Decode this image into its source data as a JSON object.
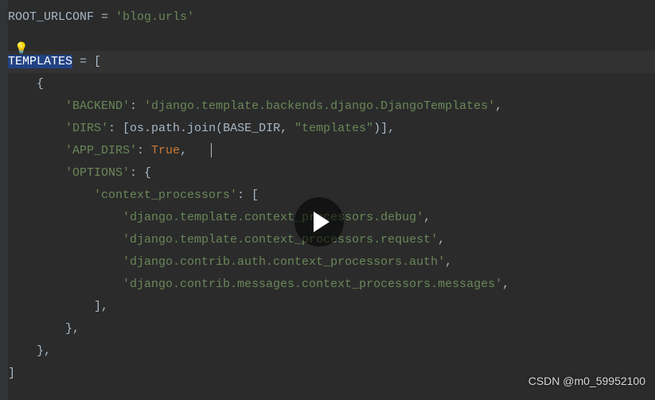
{
  "code": {
    "l1_var": "ROOT_URLCONF",
    "l1_eq": " = ",
    "l1_val": "'blog.urls'",
    "l3_var": "TEMPLATES",
    "l3_rest": " = [",
    "l4": "    {",
    "l5_key": "        'BACKEND'",
    "l5_colon": ": ",
    "l5_val": "'django.template.backends.django.DjangoTemplates'",
    "l5_comma": ",",
    "l6_key": "        'DIRS'",
    "l6_colon": ": [",
    "l6_func": "os.path.join(",
    "l6_arg1": "BASE_DIR",
    "l6_comma1": ", ",
    "l6_arg2": "\"templates\"",
    "l6_close": ")],",
    "l7_key": "        'APP_DIRS'",
    "l7_colon": ": ",
    "l7_val": "True",
    "l7_comma": ",",
    "l8_key": "        'OPTIONS'",
    "l8_colon": ": {",
    "l9_key": "            'context_processors'",
    "l9_colon": ": [",
    "l10": "                'django.template.context_processors.debug'",
    "l10_comma": ",",
    "l11": "                'django.template.context_processors.request'",
    "l11_comma": ",",
    "l12": "                'django.contrib.auth.context_processors.auth'",
    "l12_comma": ",",
    "l13": "                'django.contrib.messages.context_processors.messages'",
    "l13_comma": ",",
    "l14": "            ],",
    "l15": "        },",
    "l16": "    },",
    "l17": "]"
  },
  "bulb": "💡",
  "watermark": "CSDN @m0_59952100"
}
